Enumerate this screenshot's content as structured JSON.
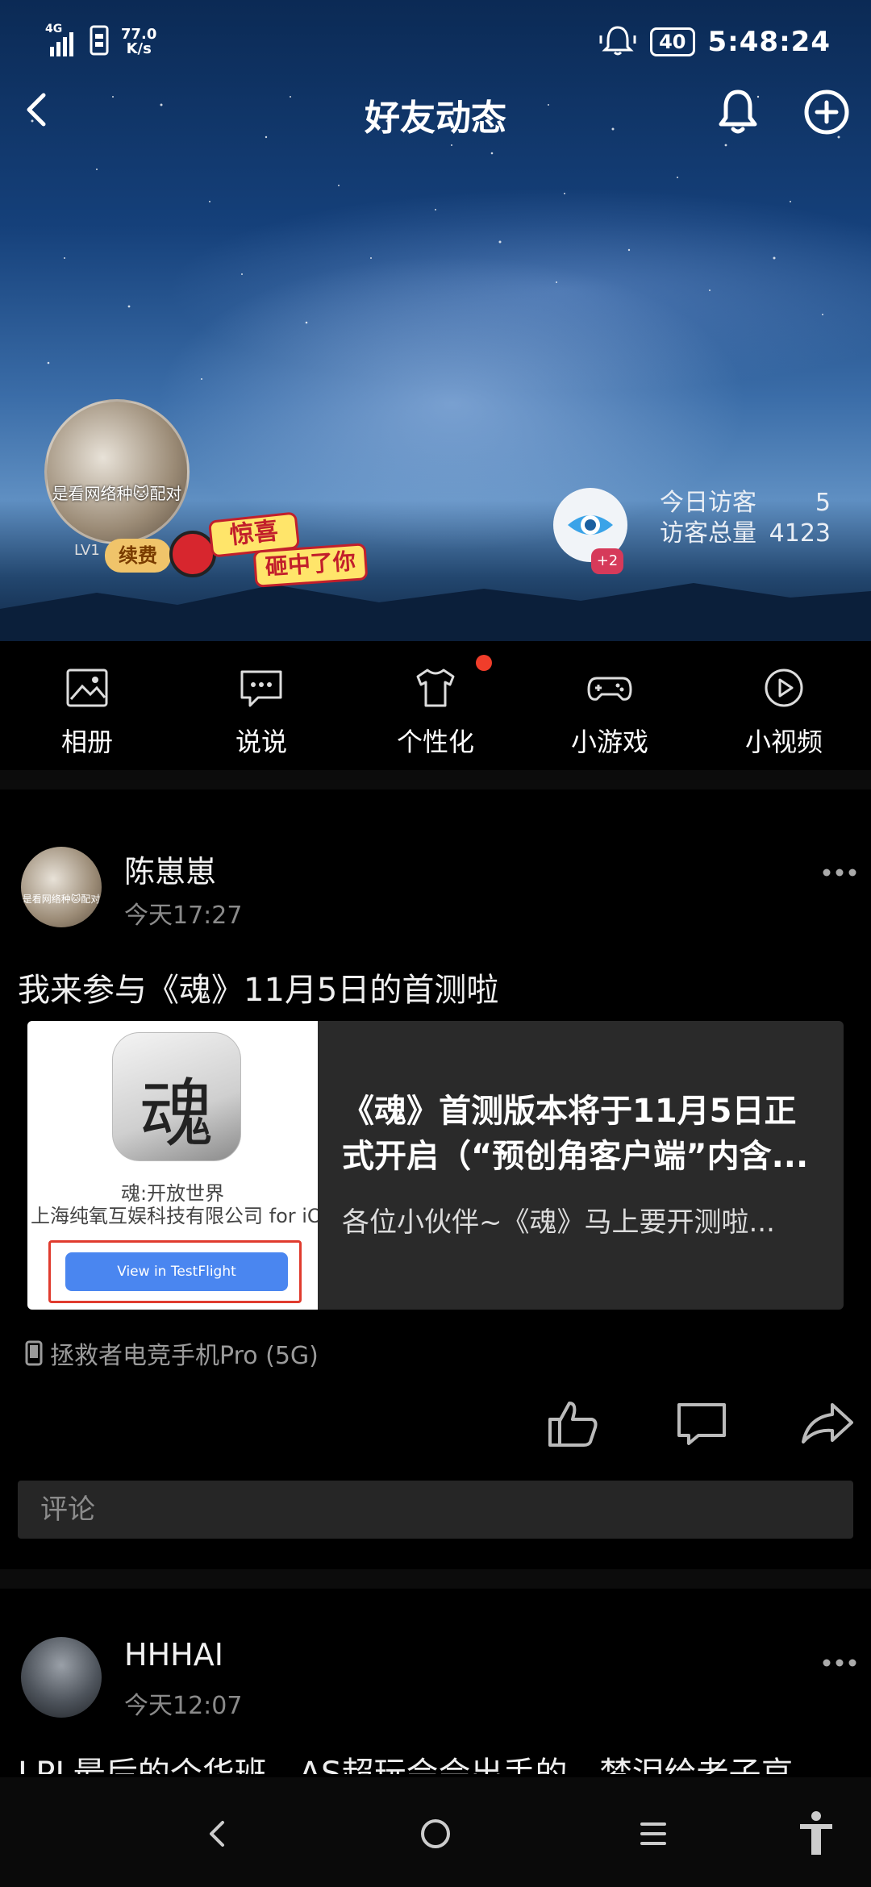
{
  "status_bar": {
    "network_type": "4G",
    "network_speed_value": "77.0",
    "network_speed_unit": "K/s",
    "battery_level": "40",
    "time": "5:48:24"
  },
  "header": {
    "title": "好友动态"
  },
  "profile": {
    "avatar_overlay_text": "是看网络种🐱配对",
    "level_badge": "LV1",
    "renew_badge": "续费",
    "sticker_text_1": "惊喜",
    "sticker_text_2": "砸中了你",
    "visitor_plus": "+2",
    "today_visitors_label": "今日访客",
    "today_visitors_value": "5",
    "total_visitors_label": "访客总量",
    "total_visitors_value": "4123"
  },
  "quick_menu": [
    {
      "label": "相册",
      "icon": "album-icon"
    },
    {
      "label": "说说",
      "icon": "chat-bubble-icon"
    },
    {
      "label": "个性化",
      "icon": "tshirt-icon"
    },
    {
      "label": "小游戏",
      "icon": "gamepad-icon"
    },
    {
      "label": "小视频",
      "icon": "play-video-icon"
    }
  ],
  "posts": [
    {
      "author": "陈崽崽",
      "avatar_overlay_text": "是看网络种🐱配对",
      "time": "今天17:27",
      "text": "我来参与《魂》11月5日的首测啦",
      "link_card": {
        "app_icon_glyph": "魂",
        "app_name": "魂:开放世界",
        "app_company": "上海纯氧互娱科技有限公司 for iOS",
        "testflight_button": "View in TestFlight",
        "title": "《魂》首测版本将于11月5日正式开启（“预创角客户端”内含...",
        "description": "各位小伙伴~《魂》马上要开测啦..."
      },
      "device": "拯救者电竞手机Pro (5G)",
      "comment_placeholder": "评论"
    },
    {
      "author": "HHHAI",
      "time": "今天12:07",
      "text": "LPL最后的个华班，AS超玩会会出手的，梦泪给老子哀"
    }
  ],
  "colors": {
    "background": "#000000",
    "notification_dot": "#f03d2a",
    "highlight_frame": "#e03b2e",
    "testflight_blue": "#4a86f0"
  }
}
